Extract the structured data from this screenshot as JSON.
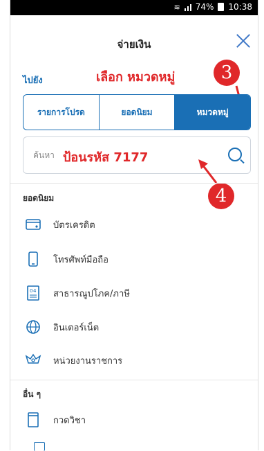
{
  "status": {
    "signal": "74%",
    "time": "10:38"
  },
  "header": {
    "title": "จ่ายเงิน"
  },
  "goto_label": "ไปยัง",
  "annotations": {
    "select_category": "เลือก หมวดหมู่",
    "enter_code": "ป้อนรหัส 7177",
    "step3": "3",
    "step4": "4"
  },
  "tabs": [
    {
      "label": "รายการโปรด",
      "active": false
    },
    {
      "label": "ยอดนิยม",
      "active": false
    },
    {
      "label": "หมวดหมู่",
      "active": true
    }
  ],
  "search": {
    "placeholder": "ค้นหา"
  },
  "sections": {
    "popular": "ยอดนิยม",
    "others": "อื่น ๆ"
  },
  "popular_items": [
    {
      "label": "บัตรเครดิต",
      "icon": "credit-card-icon"
    },
    {
      "label": "โทรศัพท์มือถือ",
      "icon": "mobile-phone-icon"
    },
    {
      "label": "สาธารณูปโภค/ภาษี",
      "icon": "utility-bill-icon"
    },
    {
      "label": "อินเตอร์เน็ต",
      "icon": "globe-icon"
    },
    {
      "label": "หน่วยงานราชการ",
      "icon": "government-emblem-icon"
    }
  ],
  "other_items": [
    {
      "label": "กวดวิชา",
      "icon": "book-icon"
    }
  ],
  "colors": {
    "primary": "#1a6fb5",
    "annotation": "#e0282a"
  }
}
